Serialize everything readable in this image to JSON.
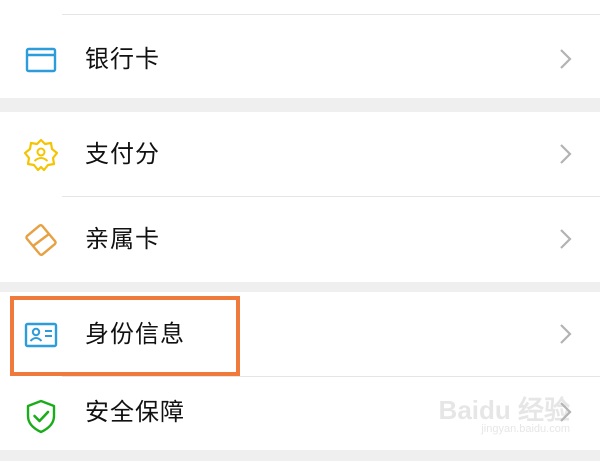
{
  "settings_list": {
    "bank_card": {
      "label": "银行卡",
      "icon": "card-icon"
    },
    "payscore": {
      "label": "支付分",
      "icon": "badge-icon"
    },
    "family_card": {
      "label": "亲属卡",
      "icon": "family-card-icon"
    },
    "identity_info": {
      "label": "身份信息",
      "icon": "id-card-icon"
    },
    "security": {
      "label": "安全保障",
      "icon": "shield-check-icon"
    }
  },
  "highlight_color": "#f07a3c",
  "icon_colors": {
    "blue": "#2d9cdb",
    "yellow": "#f5c400",
    "orange": "#e7a042",
    "green": "#1aad19"
  },
  "watermark": {
    "main": "Baidu 经验",
    "sub": "jingyan.baidu.com"
  }
}
